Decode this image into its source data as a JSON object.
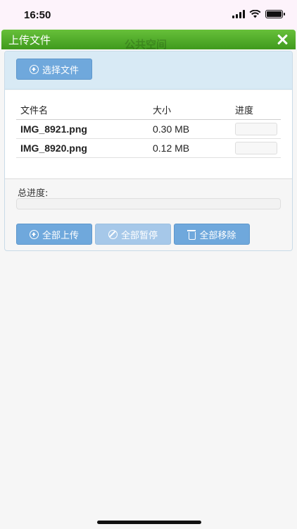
{
  "status_bar": {
    "time": "16:50"
  },
  "dialog": {
    "title": "上传文件",
    "background_title": "公共空间",
    "select_files_label": "选择文件",
    "columns": {
      "name": "文件名",
      "size": "大小",
      "progress": "进度"
    },
    "files": [
      {
        "name": "IMG_8921.png",
        "size": "0.30 MB",
        "progress": 0
      },
      {
        "name": "IMG_8920.png",
        "size": "0.12 MB",
        "progress": 0
      }
    ],
    "total_progress_label": "总进度:",
    "total_progress": 0,
    "upload_all_label": "全部上传",
    "pause_all_label": "全部暂停",
    "remove_all_label": "全部移除"
  },
  "colors": {
    "header_green": "#4caf2a",
    "button_blue": "#6fa8dc",
    "button_disabled": "#a6c8e9"
  }
}
